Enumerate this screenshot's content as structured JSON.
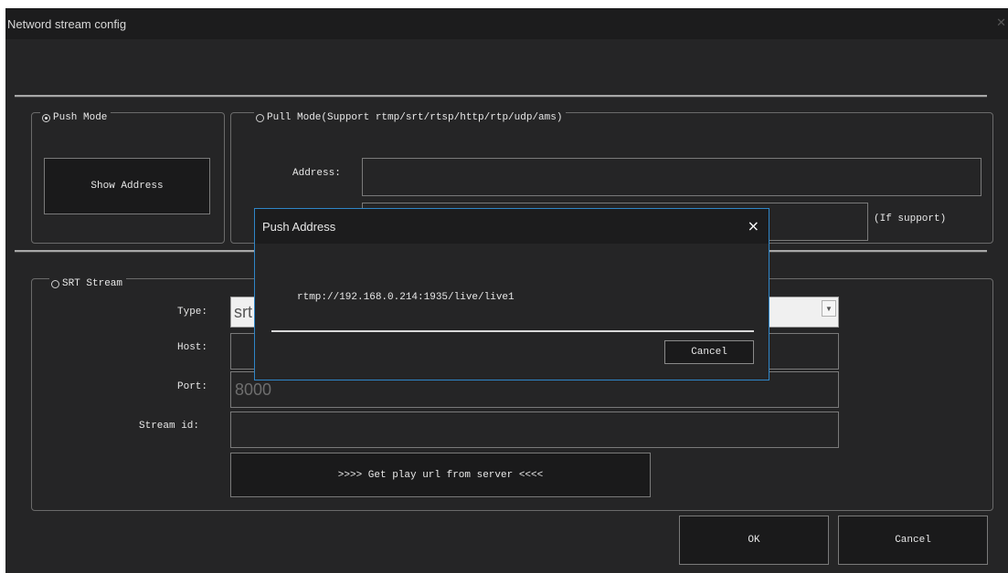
{
  "window": {
    "title": "Netword stream config"
  },
  "push_mode": {
    "label": "Push Mode",
    "selected": true,
    "show_address_button": "Show Address"
  },
  "pull_mode": {
    "label": "Pull Mode(Support rtmp/srt/rtsp/http/rtp/udp/ams)",
    "selected": false,
    "address_label": "Address:",
    "address_value": "",
    "second_value": "",
    "if_support_label": "(If support)"
  },
  "srt_stream": {
    "label": "SRT Stream",
    "selected": false,
    "type_label": "Type:",
    "type_value": "srt",
    "host_label": "Host:",
    "host_value": "",
    "port_label": "Port:",
    "port_value": "8000",
    "stream_id_label": "Stream id:",
    "stream_id_value": "",
    "get_play_url_button": ">>>> Get play url from server <<<<"
  },
  "footer": {
    "ok_button": "OK",
    "cancel_button": "Cancel"
  },
  "push_address_dialog": {
    "title": "Push Address",
    "close_icon": "×",
    "url": "rtmp://192.168.0.214:1935/live/live1",
    "cancel_button": "Cancel"
  },
  "colors": {
    "background": "#252526",
    "titlebar": "#1c1c1d",
    "dialog_border": "#2f86c8"
  }
}
